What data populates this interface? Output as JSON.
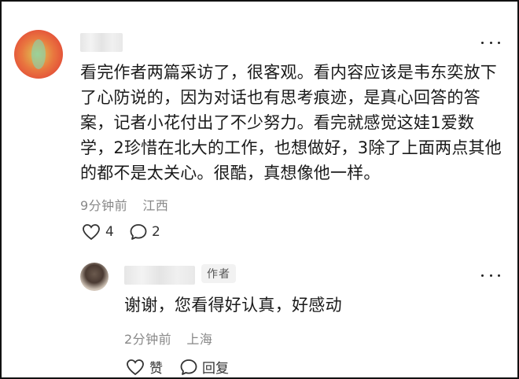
{
  "comment": {
    "text": "看完作者两篇采访了，很客观。看内容应该是韦东奕放下了心防说的，因为对话也有思考痕迹，是真心回答的答案，记者小花付出了不少努力。看完就感觉这娃1爱数学，2珍惜在北大的工作，也想做好，3除了上面两点其他的都不是太关心。很酷，真想像他一样。",
    "time": "9分钟前",
    "location": "江西",
    "like_count": "4",
    "reply_count": "2",
    "icons": {
      "avatar": "user-avatar",
      "more": "more-dots-icon",
      "like": "heart-icon",
      "reply": "comment-bubble-icon"
    }
  },
  "reply": {
    "author_badge": "作者",
    "text": "谢谢，您看得好认真，好感动",
    "time": "2分钟前",
    "location": "上海",
    "like_label": "赞",
    "reply_label": "回复",
    "icons": {
      "avatar": "author-avatar",
      "more": "more-dots-icon",
      "like": "heart-icon",
      "reply": "comment-bubble-icon"
    }
  },
  "colors": {
    "text": "#1a1a1a",
    "meta": "#888888",
    "badge_bg": "#f2f2f2"
  }
}
